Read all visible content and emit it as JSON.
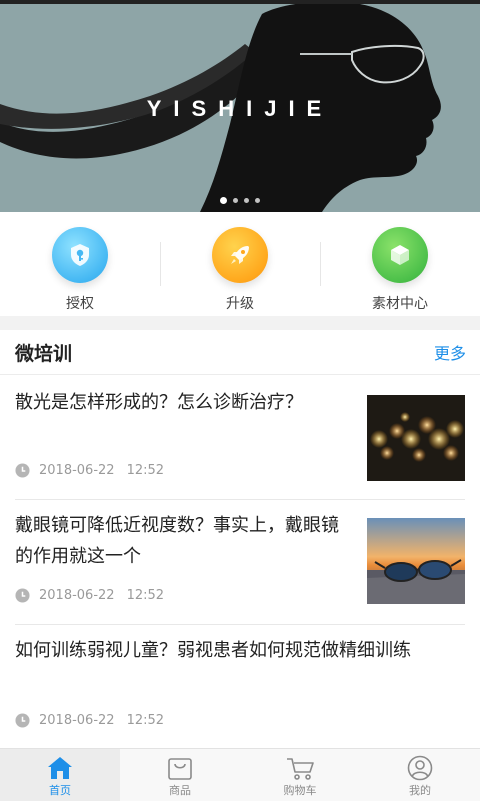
{
  "banner": {
    "text": "YISHIJIE",
    "dot_count": 4,
    "active_dot": 0
  },
  "quick_menu": [
    {
      "label": "授权",
      "icon": "key-shield-icon",
      "color": "#3fb1ef"
    },
    {
      "label": "升级",
      "icon": "rocket-icon",
      "color": "#ffa51f"
    },
    {
      "label": "素材中心",
      "icon": "cube-icon",
      "color": "#45bc45"
    }
  ],
  "training": {
    "title": "微培训",
    "more_label": "更多",
    "articles": [
      {
        "title": "散光是怎样形成的？怎么诊断治疗？",
        "date": "2018-06-22",
        "time": "12:52",
        "thumb": "bokeh-lights"
      },
      {
        "title": "戴眼镜可降低近视度数？事实上，戴眼镜的作用就这一个",
        "date": "2018-06-22",
        "time": "12:52",
        "thumb": "sunglasses-sunset"
      },
      {
        "title": "如何训练弱视儿童？弱视患者如何规范做精细训练",
        "date": "2018-06-22",
        "time": "12:52",
        "thumb": ""
      }
    ]
  },
  "tabbar": {
    "tabs": [
      {
        "label": "首页",
        "icon": "home-icon",
        "active": true
      },
      {
        "label": "商品",
        "icon": "bag-icon",
        "active": false
      },
      {
        "label": "购物车",
        "icon": "cart-icon",
        "active": false
      },
      {
        "label": "我的",
        "icon": "user-icon",
        "active": false
      }
    ],
    "active_color": "#1e8fe8",
    "inactive_color": "#8a8a8a"
  }
}
